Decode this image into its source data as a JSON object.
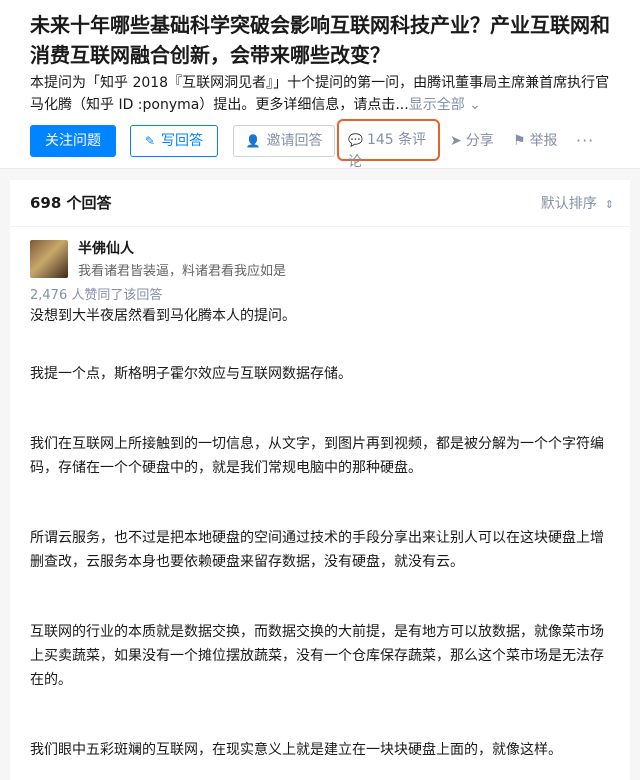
{
  "question": {
    "title": "未来十年哪些基础科学突破会影响互联网科技产业？产业互联网和消费互联网融合创新，会带来哪些改变？",
    "detail": "本提问为「知乎 2018『互联网洞见者』」十个提问的第一问，由腾讯董事局主席兼首席执行官马化腾（知乎 ID :ponyma）提出。更多详细信息，请点击...",
    "show_all": "显示全部 ⌄"
  },
  "actions": {
    "follow": "关注问题",
    "write": "写回答",
    "invite": "邀请回答",
    "comments": "145 条评论",
    "share": "分享",
    "report": "举报",
    "more": "···"
  },
  "answers": {
    "count": "698 个回答",
    "sort": "默认排序"
  },
  "answer": {
    "author": "半佛仙人",
    "bio": "我看诸君皆装逼，料诸君看我应如是",
    "votes": "2,476 人赞同了该回答",
    "paragraphs": [
      "没想到大半夜居然看到马化腾本人的提问。",
      "我提一个点，斯格明子霍尔效应与互联网数据存储。",
      "我们在互联网上所接触到的一切信息，从文字，到图片再到视频，都是被分解为一个个字符编码，存储在一个个硬盘中的，就是我们常规电脑中的那种硬盘。",
      "所谓云服务，也不过是把本地硬盘的空间通过技术的手段分享出来让别人可以在这块硬盘上增删查改，云服务本身也要依赖硬盘来留存数据，没有硬盘，就没有云。",
      "互联网的行业的本质就是数据交换，而数据交换的大前提，是有地方可以放数据，就像菜市场上买卖蔬菜，如果没有一个摊位摆放蔬菜，没有一个仓库保存蔬菜，那么这个菜市场是无法存在的。",
      "我们眼中五彩斑斓的互联网，在现实意义上就是建立在一块块硬盘上面的，就像这样。"
    ]
  }
}
